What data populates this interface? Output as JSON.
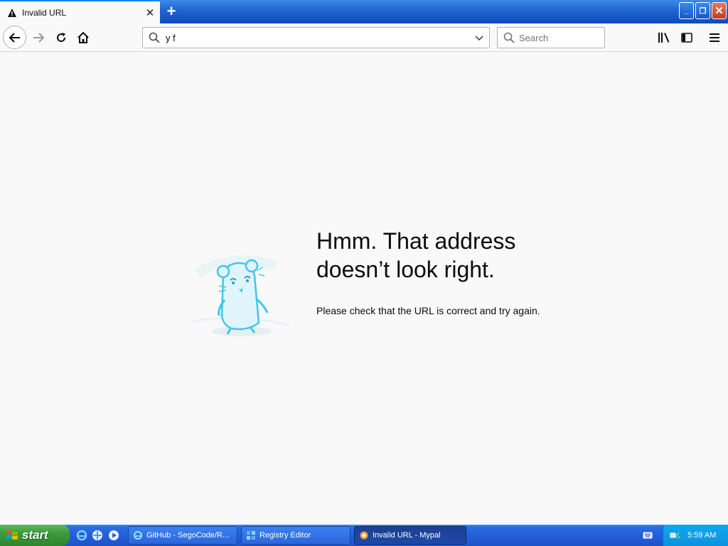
{
  "browser": {
    "tab": {
      "title": "Invalid URL",
      "close_glyph": "✕"
    },
    "new_tab_glyph": "+",
    "window_buttons": {
      "minimize": "_",
      "restore": "❐",
      "close": "✕"
    },
    "url": {
      "value": "y f"
    },
    "search": {
      "placeholder": "Search"
    }
  },
  "error_page": {
    "heading_line1": "Hmm. That address",
    "heading_line2": "doesn’t look right.",
    "description": "Please check that the URL is correct and try again."
  },
  "taskbar": {
    "start_label": "start",
    "tasks": [
      {
        "label": "GitHub - SegoCode/R..."
      },
      {
        "label": "Registry Editor"
      },
      {
        "label": "Invalid URL - Mypal"
      }
    ],
    "clock": "5:59 AM"
  },
  "colors": {
    "xp_blue": "#245edb",
    "start_green": "#3c9a3c",
    "page_background": "#f9f9fa",
    "mascot_cyan": "#43c6e8"
  }
}
